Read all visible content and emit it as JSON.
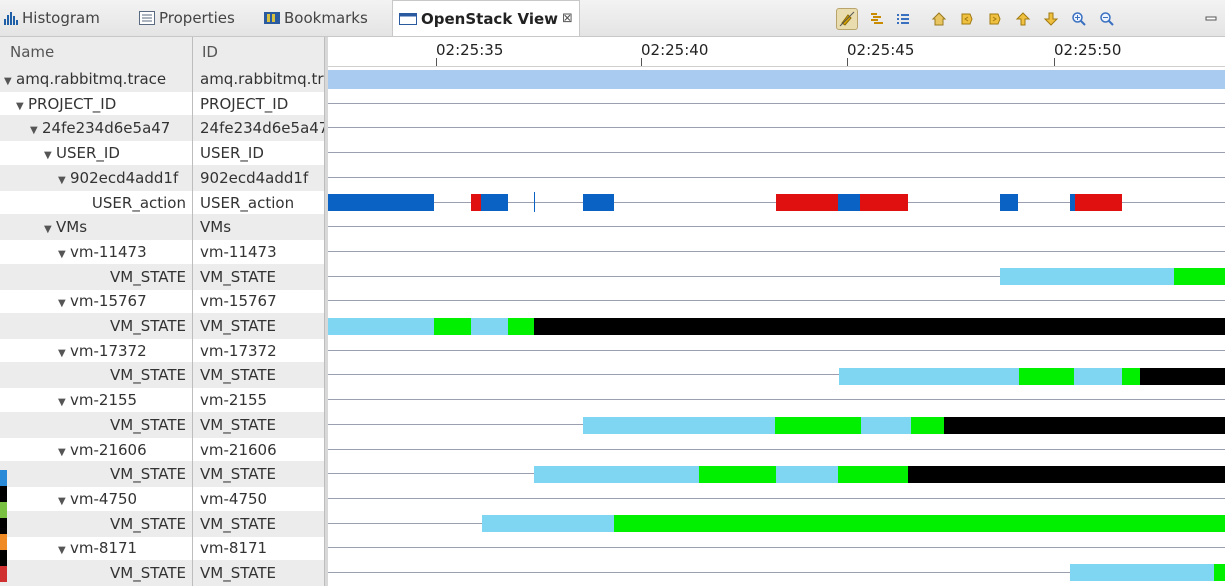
{
  "tabs": [
    {
      "label": "Histogram",
      "icon": "histogram-icon"
    },
    {
      "label": "Properties",
      "icon": "properties-icon"
    },
    {
      "label": "Bookmarks",
      "icon": "bookmarks-icon"
    },
    {
      "label": "OpenStack View",
      "icon": "view-icon",
      "active": true,
      "close": "⊠"
    }
  ],
  "toolbar": [
    "sync-icon",
    "filter-icon",
    "list-icon",
    "home-icon",
    "prev-event-icon",
    "next-event-icon",
    "up-icon",
    "down-icon",
    "zoom-in-icon",
    "zoom-out-icon",
    "minimize-icon"
  ],
  "columns": {
    "name": "Name",
    "id": "ID"
  },
  "time_labels": [
    "02:25:35",
    "02:25:40",
    "02:25:45",
    "02:25:50"
  ],
  "rows": [
    {
      "name": "amq.rabbitmq.trace",
      "id": "amq.rabbitmq.trace",
      "level": 0,
      "expanded": true
    },
    {
      "name": "PROJECT_ID",
      "id": "PROJECT_ID",
      "level": 1,
      "expanded": true
    },
    {
      "name": "24fe234d6e5a47",
      "id": "24fe234d6e5a47",
      "level": 2,
      "expanded": true
    },
    {
      "name": "USER_ID",
      "id": "USER_ID",
      "level": 3,
      "expanded": true
    },
    {
      "name": "902ecd4add1f",
      "id": "902ecd4add1f",
      "level": 4,
      "expanded": true
    },
    {
      "name": "USER_action",
      "id": "USER_action",
      "level": 5
    },
    {
      "name": "VMs",
      "id": "VMs",
      "level": 3,
      "expanded": true
    },
    {
      "name": "vm-11473",
      "id": "vm-11473",
      "level": 4,
      "expanded": true
    },
    {
      "name": "VM_STATE",
      "id": "VM_STATE",
      "level": 5
    },
    {
      "name": "vm-15767",
      "id": "vm-15767",
      "level": 4,
      "expanded": true
    },
    {
      "name": "VM_STATE",
      "id": "VM_STATE",
      "level": 5
    },
    {
      "name": "vm-17372",
      "id": "vm-17372",
      "level": 4,
      "expanded": true
    },
    {
      "name": "VM_STATE",
      "id": "VM_STATE",
      "level": 5
    },
    {
      "name": "vm-2155",
      "id": "vm-2155",
      "level": 4,
      "expanded": true
    },
    {
      "name": "VM_STATE",
      "id": "VM_STATE",
      "level": 5
    },
    {
      "name": "vm-21606",
      "id": "vm-21606",
      "level": 4,
      "expanded": true
    },
    {
      "name": "VM_STATE",
      "id": "VM_STATE",
      "level": 5
    },
    {
      "name": "vm-4750",
      "id": "vm-4750",
      "level": 4,
      "expanded": true
    },
    {
      "name": "VM_STATE",
      "id": "VM_STATE",
      "level": 5
    },
    {
      "name": "vm-8171",
      "id": "vm-8171",
      "level": 4,
      "expanded": true
    },
    {
      "name": "VM_STATE",
      "id": "VM_STATE",
      "level": 5
    }
  ],
  "colors": {
    "trace": "#a9cbef",
    "action_blue": "#0a63c4",
    "action_red": "#e01010",
    "state_lightblue": "#7fd6f2",
    "state_green": "#00f000",
    "state_black": "#000000"
  }
}
